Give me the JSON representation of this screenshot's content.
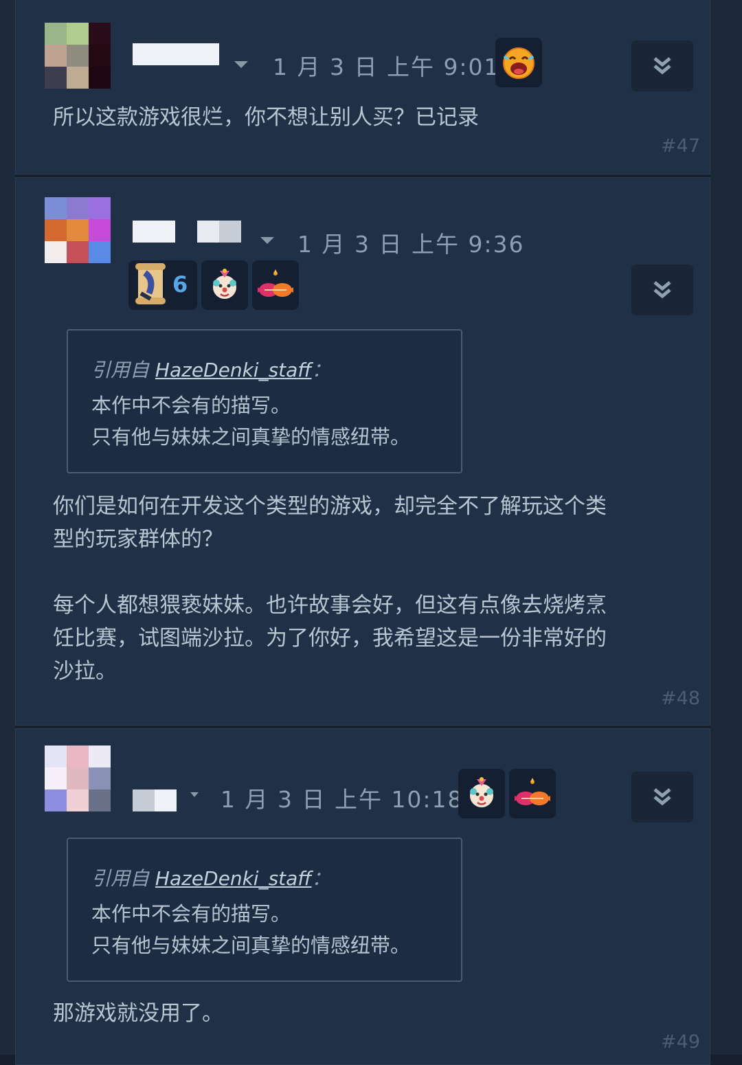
{
  "posts": [
    {
      "time": "1 月 3 日 上午 9:01",
      "badges": [
        "laughing-crying-emoji-icon"
      ],
      "text": "所以这款游戏很烂，你不想让别人买？已记录",
      "number": "#47"
    },
    {
      "time": "1 月 3 日 上午 9:36",
      "award_count": "6",
      "badges": [
        "scroll-award-icon",
        "clown-face-icon",
        "heart-candy-icon"
      ],
      "quote": {
        "prefix": "引用自",
        "author": "HazeDenki_staff",
        "colon": "：",
        "lines": [
          "本作中不会有的描写。",
          "只有他与妹妹之间真挚的情感纽带。"
        ]
      },
      "paragraphs": [
        [
          "你们是如何在开发这个类型的游戏，却完全不了解玩这个类",
          "型的玩家群体的？"
        ],
        [
          "每个人都想猥亵妹妹。也许故事会好，但这有点像去烧烤烹",
          "饪比赛，试图端沙拉。为了你好，我希望这是一份非常好的",
          "沙拉。"
        ]
      ],
      "number": "#48"
    },
    {
      "time": "1 月 3 日 上午 10:18",
      "badges": [
        "clown-face-icon",
        "heart-candy-icon"
      ],
      "quote": {
        "prefix": "引用自",
        "author": "HazeDenki_staff",
        "colon": "：",
        "lines": [
          "本作中不会有的描写。",
          "只有他与妹妹之间真挚的情感纽带。"
        ]
      },
      "text": "那游戏就没用了。",
      "number": "#49"
    }
  ],
  "colors": {
    "background": "#16202d",
    "post_bg": "#1f3047",
    "time_text": "#8da0b3",
    "body_text": "#b9c6d2",
    "award_count": "#57a8e8"
  }
}
